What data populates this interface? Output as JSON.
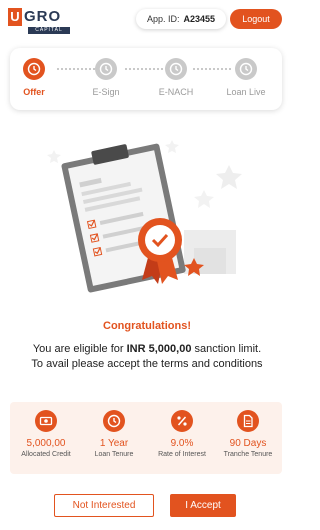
{
  "brand": {
    "logo_letter": "U",
    "logo_text": "GRO",
    "logo_sub": "CAPITAL",
    "accent": "#e2531f",
    "navy": "#2b3a55"
  },
  "header": {
    "app_id_label": "App. ID:",
    "app_id_value": "A23455",
    "logout_label": "Logout"
  },
  "steps": [
    {
      "label": "Offer",
      "icon": "clock-icon",
      "active": true
    },
    {
      "label": "E-Sign",
      "icon": "clock-icon",
      "active": false
    },
    {
      "label": "E-NACH",
      "icon": "clock-icon",
      "active": false
    },
    {
      "label": "Loan Live",
      "icon": "clock-icon",
      "active": false
    }
  ],
  "offer": {
    "heading": "Congratulations!",
    "text_before": "You are eligible for ",
    "amount": "INR 5,000,00",
    "text_after": " sanction limit. To avail please accept the terms and conditions"
  },
  "details": [
    {
      "value": "5,000,00",
      "label": "Allocated Credit",
      "icon": "money-icon"
    },
    {
      "value": "1 Year",
      "label": "Loan Tenure",
      "icon": "clock-icon"
    },
    {
      "value": "9.0%",
      "label": "Rate of Interest",
      "icon": "percent-icon"
    },
    {
      "value": "90 Days",
      "label": "Tranche Tenure",
      "icon": "document-icon"
    }
  ],
  "actions": {
    "decline_label": "Not Interested",
    "accept_label": "I Accept"
  }
}
